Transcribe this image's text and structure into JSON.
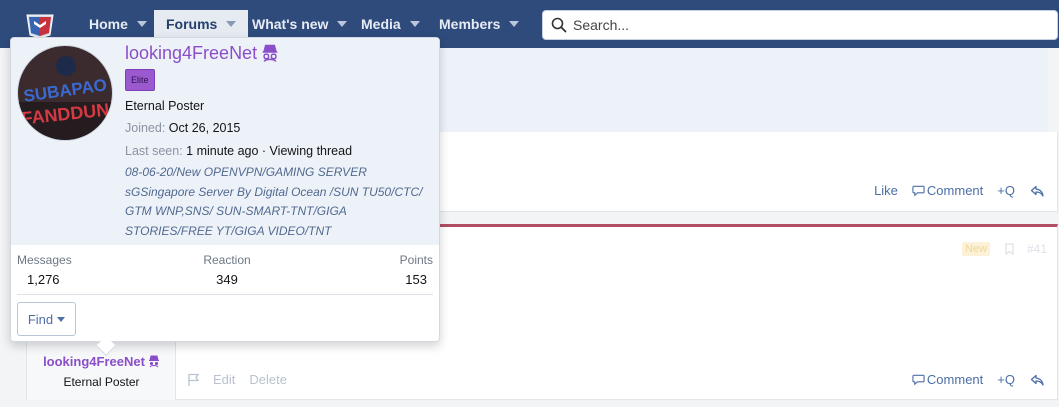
{
  "nav": {
    "tabs": [
      {
        "label": "Home"
      },
      {
        "label": "Forums"
      },
      {
        "label": "What's new"
      },
      {
        "label": "Media"
      },
      {
        "label": "Members"
      }
    ],
    "selected_tab": "Forums",
    "search_placeholder": "Search..."
  },
  "tooltip": {
    "username": "looking4FreeNet",
    "badge": "Elite",
    "user_title": "Eternal Poster",
    "joined_label": "Joined:",
    "joined_value": "Oct 26, 2015",
    "last_seen_label": "Last seen:",
    "last_seen_value": "1 minute ago · Viewing thread",
    "signature": "08-06-20/New OPENVPN/GAMING SERVER sGSingapore Server By Digital Ocean /SUN TU50/CTC/ GTM WNP,SNS/ SUN-SMART-TNT/GIGA STORIES/FREE YT/GIGA VIDEO/TNT",
    "avatar_text": "SUBAPAO FANDDUN",
    "stats": [
      {
        "label": "Messages",
        "value": "1,276"
      },
      {
        "label": "Reaction",
        "value": "349"
      },
      {
        "label": "Points",
        "value": "153"
      }
    ],
    "find_label": "Find"
  },
  "post1": {
    "actions": {
      "like": "Like",
      "comment": "Comment",
      "quote": "+Q"
    }
  },
  "post2": {
    "username": "looking4FreeNet",
    "user_title": "Eternal Poster",
    "new_badge": "New",
    "post_number": "#41",
    "mod_actions": {
      "edit": "Edit",
      "delete": "Delete"
    },
    "actions": {
      "comment": "Comment",
      "quote": "+Q"
    }
  },
  "colors": {
    "navbar": "#2f4b7c",
    "username": "#8a4fc8",
    "badge": "#9b59d0",
    "link": "#4c6fa6",
    "post_accent": "#b14e64"
  }
}
